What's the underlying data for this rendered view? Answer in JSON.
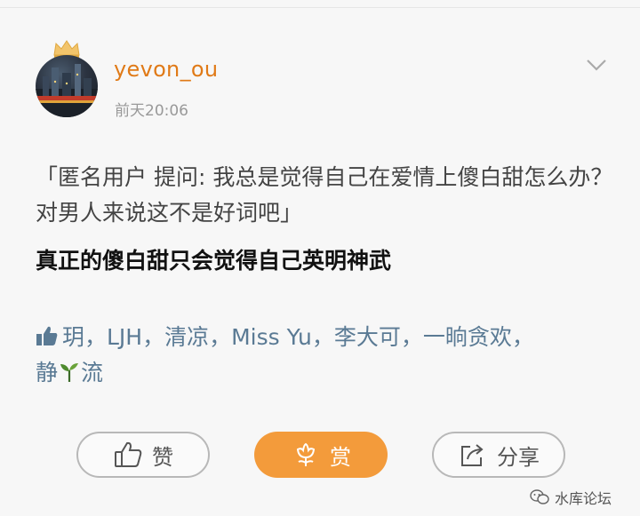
{
  "post": {
    "username": "yevon_ou",
    "timestamp": "前天20:06",
    "question": "「匿名用户  提问: 我总是觉得自己在爱情上傻白甜怎么办？  对男人来说这不是好词吧」",
    "answer": "真正的傻白甜只会觉得自己英明神武"
  },
  "likes": {
    "names_line": "玥，LJH，清凉，Miss Yu，李大可，一晌贪欢，",
    "last_name_part1": "静",
    "last_name_part2": "流"
  },
  "actions": {
    "like_label": "赞",
    "reward_label": "赏",
    "share_label": "分享"
  },
  "watermark": {
    "text": "水库论坛"
  },
  "colors": {
    "username": "#e07a17",
    "reward_button": "#f39b3b",
    "like_names": "#5a7a94"
  }
}
